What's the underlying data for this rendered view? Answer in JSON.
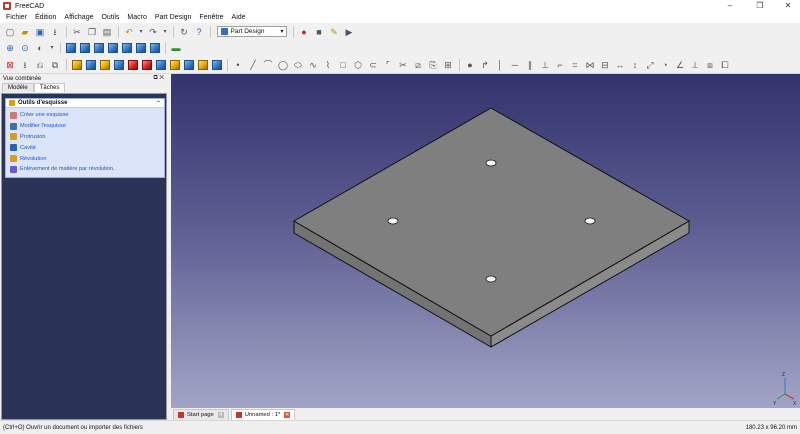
{
  "window": {
    "title": "FreeCAD",
    "controls": [
      "–",
      "❐",
      "✕"
    ]
  },
  "menu": [
    "Fichier",
    "Édition",
    "Affichage",
    "Outils",
    "Macro",
    "Part Design",
    "Fenêtre",
    "Aide"
  ],
  "toolbar": {
    "workbench": "Part Design"
  },
  "combo": {
    "title": "Vue combinée",
    "tabs": [
      "Modèle",
      "Tâches"
    ],
    "task_panel": {
      "header": "Outils d'esquisse",
      "items": [
        {
          "label": "Créer une esquisse",
          "icon": "sketch-new-icon",
          "color": "#d07878"
        },
        {
          "label": "Modifier l'esquisse",
          "icon": "sketch-edit-icon",
          "color": "#4a6aa8"
        },
        {
          "label": "Protrusion",
          "icon": "pad-icon",
          "color": "#d4a017"
        },
        {
          "label": "Cavité",
          "icon": "pocket-icon",
          "color": "#2f5fa8"
        },
        {
          "label": "Révolution",
          "icon": "revolution-icon",
          "color": "#d4a017"
        },
        {
          "label": "Enlèvement de matière par révolution.",
          "icon": "groove-icon",
          "color": "#6a5acd"
        }
      ]
    }
  },
  "doc_tabs": [
    {
      "label": "Start page",
      "active": false
    },
    {
      "label": "Unnamed : 1*",
      "active": true
    }
  ],
  "status": {
    "hint": "(Ctrl+O) Ouvrir un document ou importer des fichiers",
    "dimensions": "180.23 x 96.20 mm"
  },
  "colors": {
    "view_top": "#33336e",
    "view_bottom": "#a2a4c6",
    "plate": "#7f7f7f",
    "task_bg": "#dbe4f8"
  }
}
